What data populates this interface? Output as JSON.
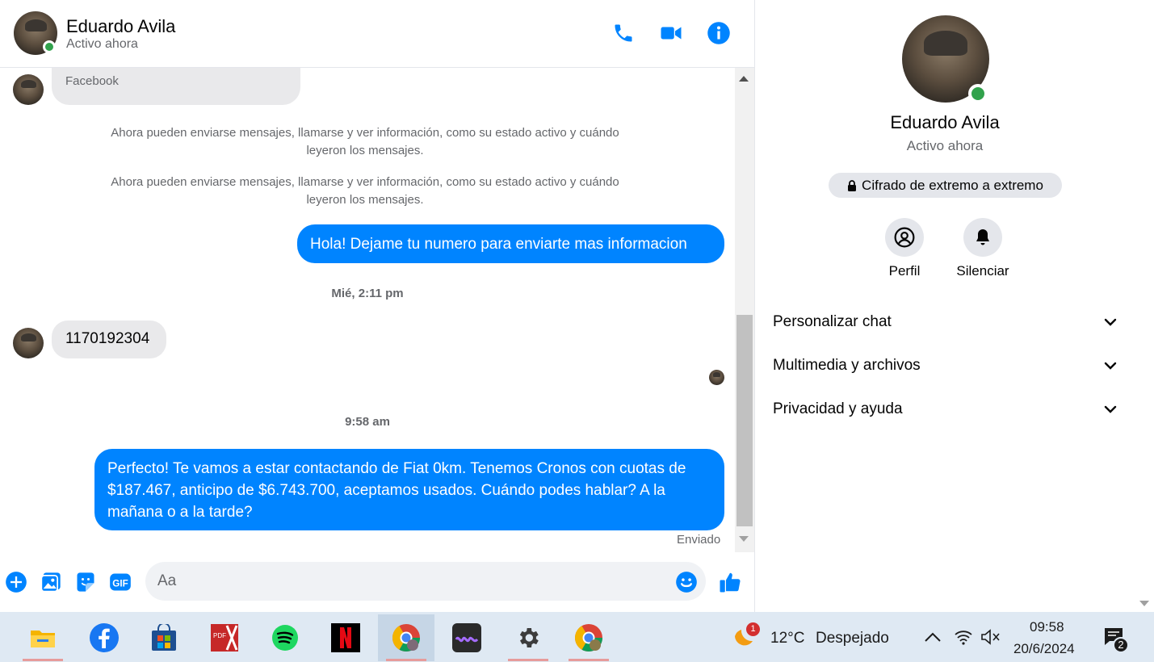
{
  "contact": {
    "name": "Eduardo Avila",
    "status": "Activo ahora"
  },
  "messages": {
    "first_bubble_text": "Facebook",
    "system_notice_1": "Ahora pueden enviarse mensajes, llamarse y ver información, como su estado activo y cuándo leyeron los mensajes.",
    "system_notice_2": "Ahora pueden enviarse mensajes, llamarse y ver información, como su estado activo y cuándo leyeron los mensajes.",
    "outgoing_1": "Hola! Dejame tu numero para enviarte mas informacion",
    "time_1": "Mié, 2:11 pm",
    "incoming_1": "1170192304",
    "time_2": "9:58 am",
    "outgoing_2": "Perfecto! Te vamos a estar contactando de Fiat 0km. Tenemos Cronos con cuotas de $187.467, anticipo de $6.743.700, aceptamos usados. Cuándo podes hablar? A la mañana o a la tarde?",
    "delivery_status": "Enviado"
  },
  "composer": {
    "placeholder": "Aa"
  },
  "panel": {
    "name": "Eduardo Avila",
    "status": "Activo ahora",
    "encryption": "Cifrado de extremo a extremo",
    "profile_label": "Perfil",
    "mute_label": "Silenciar",
    "sections": [
      "Personalizar chat",
      "Multimedia y archivos",
      "Privacidad y ayuda"
    ]
  },
  "taskbar": {
    "weather_temp": "12°C",
    "weather_desc": "Despejado",
    "weather_badge": "1",
    "time": "09:58",
    "date": "20/6/2024",
    "notification_count": "2",
    "pdf_label": "PDF"
  },
  "colors": {
    "accent": "#0084ff",
    "online": "#31a24c"
  }
}
